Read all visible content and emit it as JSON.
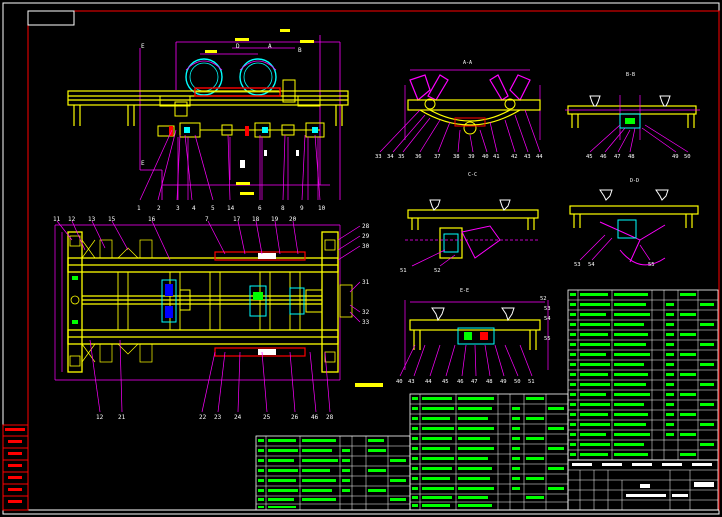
{
  "colors": {
    "background": "#000000",
    "frame": "#ff0000",
    "border": "#ffffff",
    "steel": "#ffff00",
    "detail": "#00ffff",
    "leader": "#ff00ff",
    "table": "#00ff00",
    "hatch": "#0000ff",
    "accent": "#ff0000"
  },
  "section_labels": {
    "aa": "A-A",
    "bb": "B-B",
    "cc": "C-C",
    "dd": "D-D",
    "ee": "E-E"
  },
  "front_view_top_dims": [
    "D",
    "A",
    "B"
  ],
  "front_view_callouts": [
    "1",
    "2",
    "3",
    "4",
    "5",
    "14",
    "6",
    "8",
    "9",
    "10"
  ],
  "plan_view_top_callouts": [
    "11",
    "12",
    "13",
    "15",
    "16",
    "7",
    "17",
    "18",
    "19",
    "20"
  ],
  "plan_view_bottom_callouts": [
    "12",
    "21",
    "22",
    "23",
    "24",
    "25",
    "26",
    "46",
    "28"
  ],
  "plan_view_right_callouts": [
    "28",
    "29",
    "30",
    "31",
    "32",
    "33"
  ],
  "section_aa_callouts": [
    "33",
    "34",
    "35",
    "36",
    "37",
    "38",
    "39",
    "40",
    "41",
    "42",
    "43",
    "44"
  ],
  "section_bb_callouts": [
    "45",
    "46",
    "47",
    "48",
    "49",
    "50"
  ],
  "section_cc_callouts": [
    "51",
    "52"
  ],
  "section_dd_callouts": [
    "53",
    "54",
    "55"
  ],
  "section_ee_callouts": [
    "40",
    "43",
    "44",
    "45",
    "46",
    "47",
    "48",
    "49",
    "50",
    "51",
    "52",
    "53",
    "54",
    "55"
  ],
  "icons": [
    "section-marker-icon",
    "weld-symbol-icon"
  ]
}
